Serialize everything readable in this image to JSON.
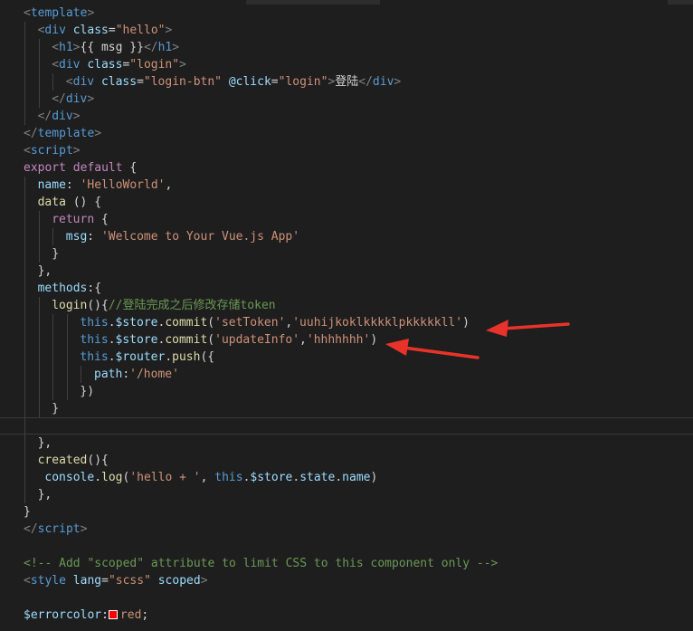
{
  "colors": {
    "background": "#1e1e1e",
    "annotation_arrow": "#e8332a",
    "swatch": "#ff0000"
  },
  "code_lines": [
    {
      "indent": 0,
      "tokens": [
        [
          "punc",
          "<"
        ],
        [
          "tag",
          "template"
        ],
        [
          "punc",
          ">"
        ]
      ]
    },
    {
      "indent": 1,
      "tokens": [
        [
          "punc",
          "<"
        ],
        [
          "tag",
          "div"
        ],
        [
          "txt",
          " "
        ],
        [
          "attr",
          "class"
        ],
        [
          "txt",
          "="
        ],
        [
          "str",
          "\"hello\""
        ],
        [
          "punc",
          ">"
        ]
      ]
    },
    {
      "indent": 2,
      "tokens": [
        [
          "punc",
          "<"
        ],
        [
          "tag",
          "h1"
        ],
        [
          "punc",
          ">"
        ],
        [
          "txt",
          "{{ msg }}"
        ],
        [
          "punc",
          "</"
        ],
        [
          "tag",
          "h1"
        ],
        [
          "punc",
          ">"
        ]
      ]
    },
    {
      "indent": 2,
      "tokens": [
        [
          "punc",
          "<"
        ],
        [
          "tag",
          "div"
        ],
        [
          "txt",
          " "
        ],
        [
          "attr",
          "class"
        ],
        [
          "txt",
          "="
        ],
        [
          "str",
          "\"login\""
        ],
        [
          "punc",
          ">"
        ]
      ]
    },
    {
      "indent": 3,
      "tokens": [
        [
          "punc",
          "<"
        ],
        [
          "tag",
          "div"
        ],
        [
          "txt",
          " "
        ],
        [
          "attr",
          "class"
        ],
        [
          "txt",
          "="
        ],
        [
          "str",
          "\"login-btn\""
        ],
        [
          "txt",
          " "
        ],
        [
          "attr",
          "@click"
        ],
        [
          "txt",
          "="
        ],
        [
          "str",
          "\"login\""
        ],
        [
          "punc",
          ">"
        ],
        [
          "txt",
          "登陆"
        ],
        [
          "punc",
          "</"
        ],
        [
          "tag",
          "div"
        ],
        [
          "punc",
          ">"
        ]
      ]
    },
    {
      "indent": 2,
      "tokens": [
        [
          "punc",
          "</"
        ],
        [
          "tag",
          "div"
        ],
        [
          "punc",
          ">"
        ]
      ]
    },
    {
      "indent": 1,
      "tokens": [
        [
          "punc",
          "</"
        ],
        [
          "tag",
          "div"
        ],
        [
          "punc",
          ">"
        ]
      ]
    },
    {
      "indent": 0,
      "tokens": [
        [
          "punc",
          "</"
        ],
        [
          "tag",
          "template"
        ],
        [
          "punc",
          ">"
        ]
      ]
    },
    {
      "indent": 0,
      "tokens": [
        [
          "punc",
          "<"
        ],
        [
          "tag",
          "script"
        ],
        [
          "punc",
          ">"
        ]
      ]
    },
    {
      "indent": 0,
      "tokens": [
        [
          "kw",
          "export"
        ],
        [
          "txt",
          " "
        ],
        [
          "kw",
          "default"
        ],
        [
          "txt",
          " {"
        ]
      ]
    },
    {
      "indent": 1,
      "tokens": [
        [
          "prop",
          "name"
        ],
        [
          "txt",
          ": "
        ],
        [
          "str",
          "'HelloWorld'"
        ],
        [
          "txt",
          ","
        ]
      ]
    },
    {
      "indent": 1,
      "tokens": [
        [
          "fn",
          "data"
        ],
        [
          "txt",
          " () {"
        ]
      ]
    },
    {
      "indent": 2,
      "tokens": [
        [
          "kw",
          "return"
        ],
        [
          "txt",
          " {"
        ]
      ]
    },
    {
      "indent": 3,
      "tokens": [
        [
          "prop",
          "msg"
        ],
        [
          "txt",
          ": "
        ],
        [
          "str",
          "'Welcome to Your Vue.js App'"
        ]
      ]
    },
    {
      "indent": 2,
      "tokens": [
        [
          "txt",
          "}"
        ]
      ]
    },
    {
      "indent": 1,
      "tokens": [
        [
          "txt",
          "},"
        ]
      ]
    },
    {
      "indent": 1,
      "tokens": [
        [
          "prop",
          "methods"
        ],
        [
          "txt",
          ":{"
        ]
      ]
    },
    {
      "indent": 2,
      "tokens": [
        [
          "fn",
          "login"
        ],
        [
          "txt",
          "(){"
        ],
        [
          "com",
          "//登陆完成之后修改存储token"
        ]
      ]
    },
    {
      "indent": 4,
      "tokens": [
        [
          "key",
          "this"
        ],
        [
          "txt",
          "."
        ],
        [
          "var",
          "$store"
        ],
        [
          "txt",
          "."
        ],
        [
          "fn",
          "commit"
        ],
        [
          "txt",
          "("
        ],
        [
          "str",
          "'setToken'"
        ],
        [
          "txt",
          ","
        ],
        [
          "str",
          "'uuhijkoklkkkklpkkkkkll'"
        ],
        [
          "txt",
          ")"
        ]
      ]
    },
    {
      "indent": 4,
      "tokens": [
        [
          "key",
          "this"
        ],
        [
          "txt",
          "."
        ],
        [
          "var",
          "$store"
        ],
        [
          "txt",
          "."
        ],
        [
          "fn",
          "commit"
        ],
        [
          "txt",
          "("
        ],
        [
          "str",
          "'updateInfo'"
        ],
        [
          "txt",
          ","
        ],
        [
          "str",
          "'hhhhhhh'"
        ],
        [
          "txt",
          ")"
        ]
      ]
    },
    {
      "indent": 4,
      "tokens": [
        [
          "key",
          "this"
        ],
        [
          "txt",
          "."
        ],
        [
          "var",
          "$router"
        ],
        [
          "txt",
          "."
        ],
        [
          "fn",
          "push"
        ],
        [
          "txt",
          "({"
        ]
      ]
    },
    {
      "indent": 5,
      "tokens": [
        [
          "prop",
          "path"
        ],
        [
          "txt",
          ":"
        ],
        [
          "str",
          "'/home'"
        ]
      ]
    },
    {
      "indent": 4,
      "tokens": [
        [
          "txt",
          "})"
        ]
      ]
    },
    {
      "indent": 2,
      "tokens": [
        [
          "txt",
          "}"
        ]
      ]
    },
    {
      "indent": 1,
      "current": true,
      "tokens": []
    },
    {
      "indent": 1,
      "tokens": [
        [
          "txt",
          "},"
        ]
      ]
    },
    {
      "indent": 1,
      "tokens": [
        [
          "fn",
          "created"
        ],
        [
          "txt",
          "(){"
        ]
      ]
    },
    {
      "indent": 1,
      "extra": 1,
      "tokens": [
        [
          "var",
          "console"
        ],
        [
          "txt",
          "."
        ],
        [
          "fn",
          "log"
        ],
        [
          "txt",
          "("
        ],
        [
          "str",
          "'hello + '"
        ],
        [
          "txt",
          ", "
        ],
        [
          "key",
          "this"
        ],
        [
          "txt",
          "."
        ],
        [
          "var",
          "$store"
        ],
        [
          "txt",
          "."
        ],
        [
          "var",
          "state"
        ],
        [
          "txt",
          "."
        ],
        [
          "var",
          "name"
        ],
        [
          "txt",
          ")"
        ]
      ]
    },
    {
      "indent": 1,
      "tokens": [
        [
          "txt",
          "},"
        ]
      ]
    },
    {
      "indent": 0,
      "tokens": [
        [
          "txt",
          "}"
        ]
      ]
    },
    {
      "indent": 0,
      "tokens": [
        [
          "punc",
          "</"
        ],
        [
          "tag",
          "script"
        ],
        [
          "punc",
          ">"
        ]
      ]
    },
    {
      "indent": 0,
      "tokens": []
    },
    {
      "indent": 0,
      "tokens": [
        [
          "com",
          "<!-- Add \"scoped\" attribute to limit CSS to this component only -->"
        ]
      ]
    },
    {
      "indent": 0,
      "tokens": [
        [
          "punc",
          "<"
        ],
        [
          "tag",
          "style"
        ],
        [
          "txt",
          " "
        ],
        [
          "attr",
          "lang"
        ],
        [
          "txt",
          "="
        ],
        [
          "str",
          "\"scss\""
        ],
        [
          "txt",
          " "
        ],
        [
          "attr",
          "scoped"
        ],
        [
          "punc",
          ">"
        ]
      ]
    },
    {
      "indent": 0,
      "tokens": []
    },
    {
      "indent": 0,
      "tokens": [
        [
          "var",
          "$errorcolor"
        ],
        [
          "txt",
          ":"
        ],
        [
          "swatch",
          ""
        ],
        [
          "str",
          "red"
        ],
        [
          "txt",
          ";"
        ]
      ]
    }
  ]
}
